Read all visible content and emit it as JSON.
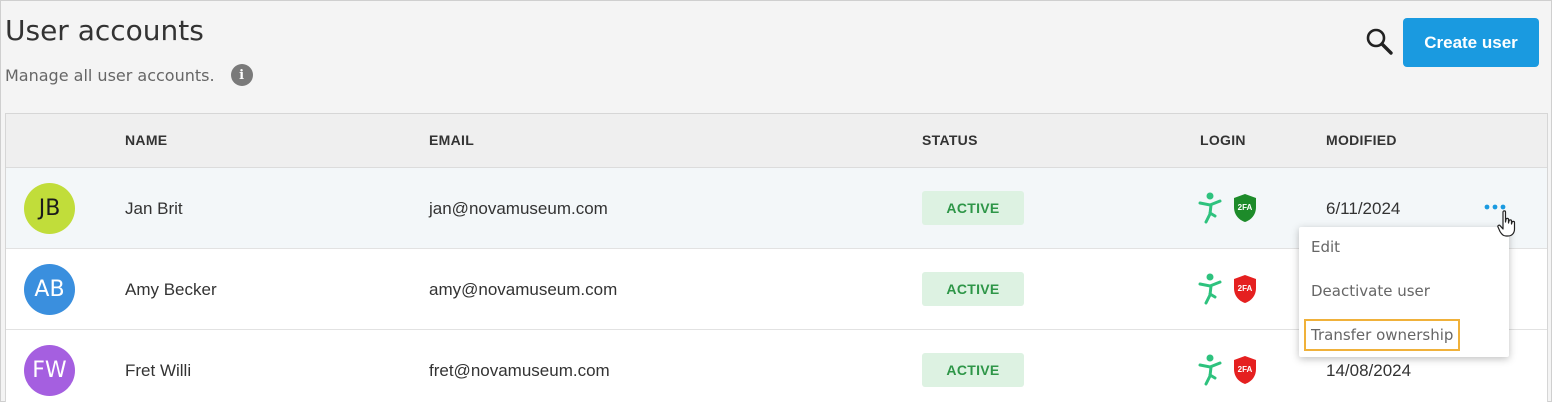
{
  "header": {
    "title": "User accounts",
    "subtitle": "Manage all user accounts.",
    "info_icon": "i",
    "create_button": "Create user"
  },
  "table": {
    "columns": {
      "name": "NAME",
      "email": "EMAIL",
      "status": "STATUS",
      "login": "LOGIN",
      "modified": "MODIFIED"
    },
    "rows": [
      {
        "initials": "JB",
        "avatar_color": "#c1dd3a",
        "avatar_text_color": "#1b1b1b",
        "name": "Jan Brit",
        "email": "jan@novamuseum.com",
        "status": "ACTIVE",
        "two_fa": "2FA",
        "two_fa_color": "#1d8b2a",
        "modified": "6/11/2024"
      },
      {
        "initials": "AB",
        "avatar_color": "#3a8fde",
        "avatar_text_color": "#ffffff",
        "name": "Amy Becker",
        "email": "amy@novamuseum.com",
        "status": "ACTIVE",
        "two_fa": "2FA",
        "two_fa_color": "#e52020",
        "modified": ""
      },
      {
        "initials": "FW",
        "avatar_color": "#a55fe0",
        "avatar_text_color": "#ffffff",
        "name": "Fret Willi",
        "email": "fret@novamuseum.com",
        "status": "ACTIVE",
        "two_fa": "2FA",
        "two_fa_color": "#e52020",
        "modified": "14/08/2024"
      }
    ]
  },
  "row_menu": {
    "items": [
      "Edit",
      "Deactivate user",
      "Transfer ownership"
    ],
    "focused_item": "Transfer ownership"
  },
  "colors": {
    "accent": "#1a9ae0",
    "login_icon": "#2ec27e",
    "status_bg": "#ddf2e2",
    "status_text": "#2e9648",
    "focus_outline": "#f0b13a"
  },
  "icons": {
    "search": "search-icon",
    "info": "info-icon",
    "login_method": "person-login-icon",
    "two_factor": "2fa-shield-icon",
    "more": "more-horizontal-icon",
    "pointer": "hand-cursor-icon"
  }
}
